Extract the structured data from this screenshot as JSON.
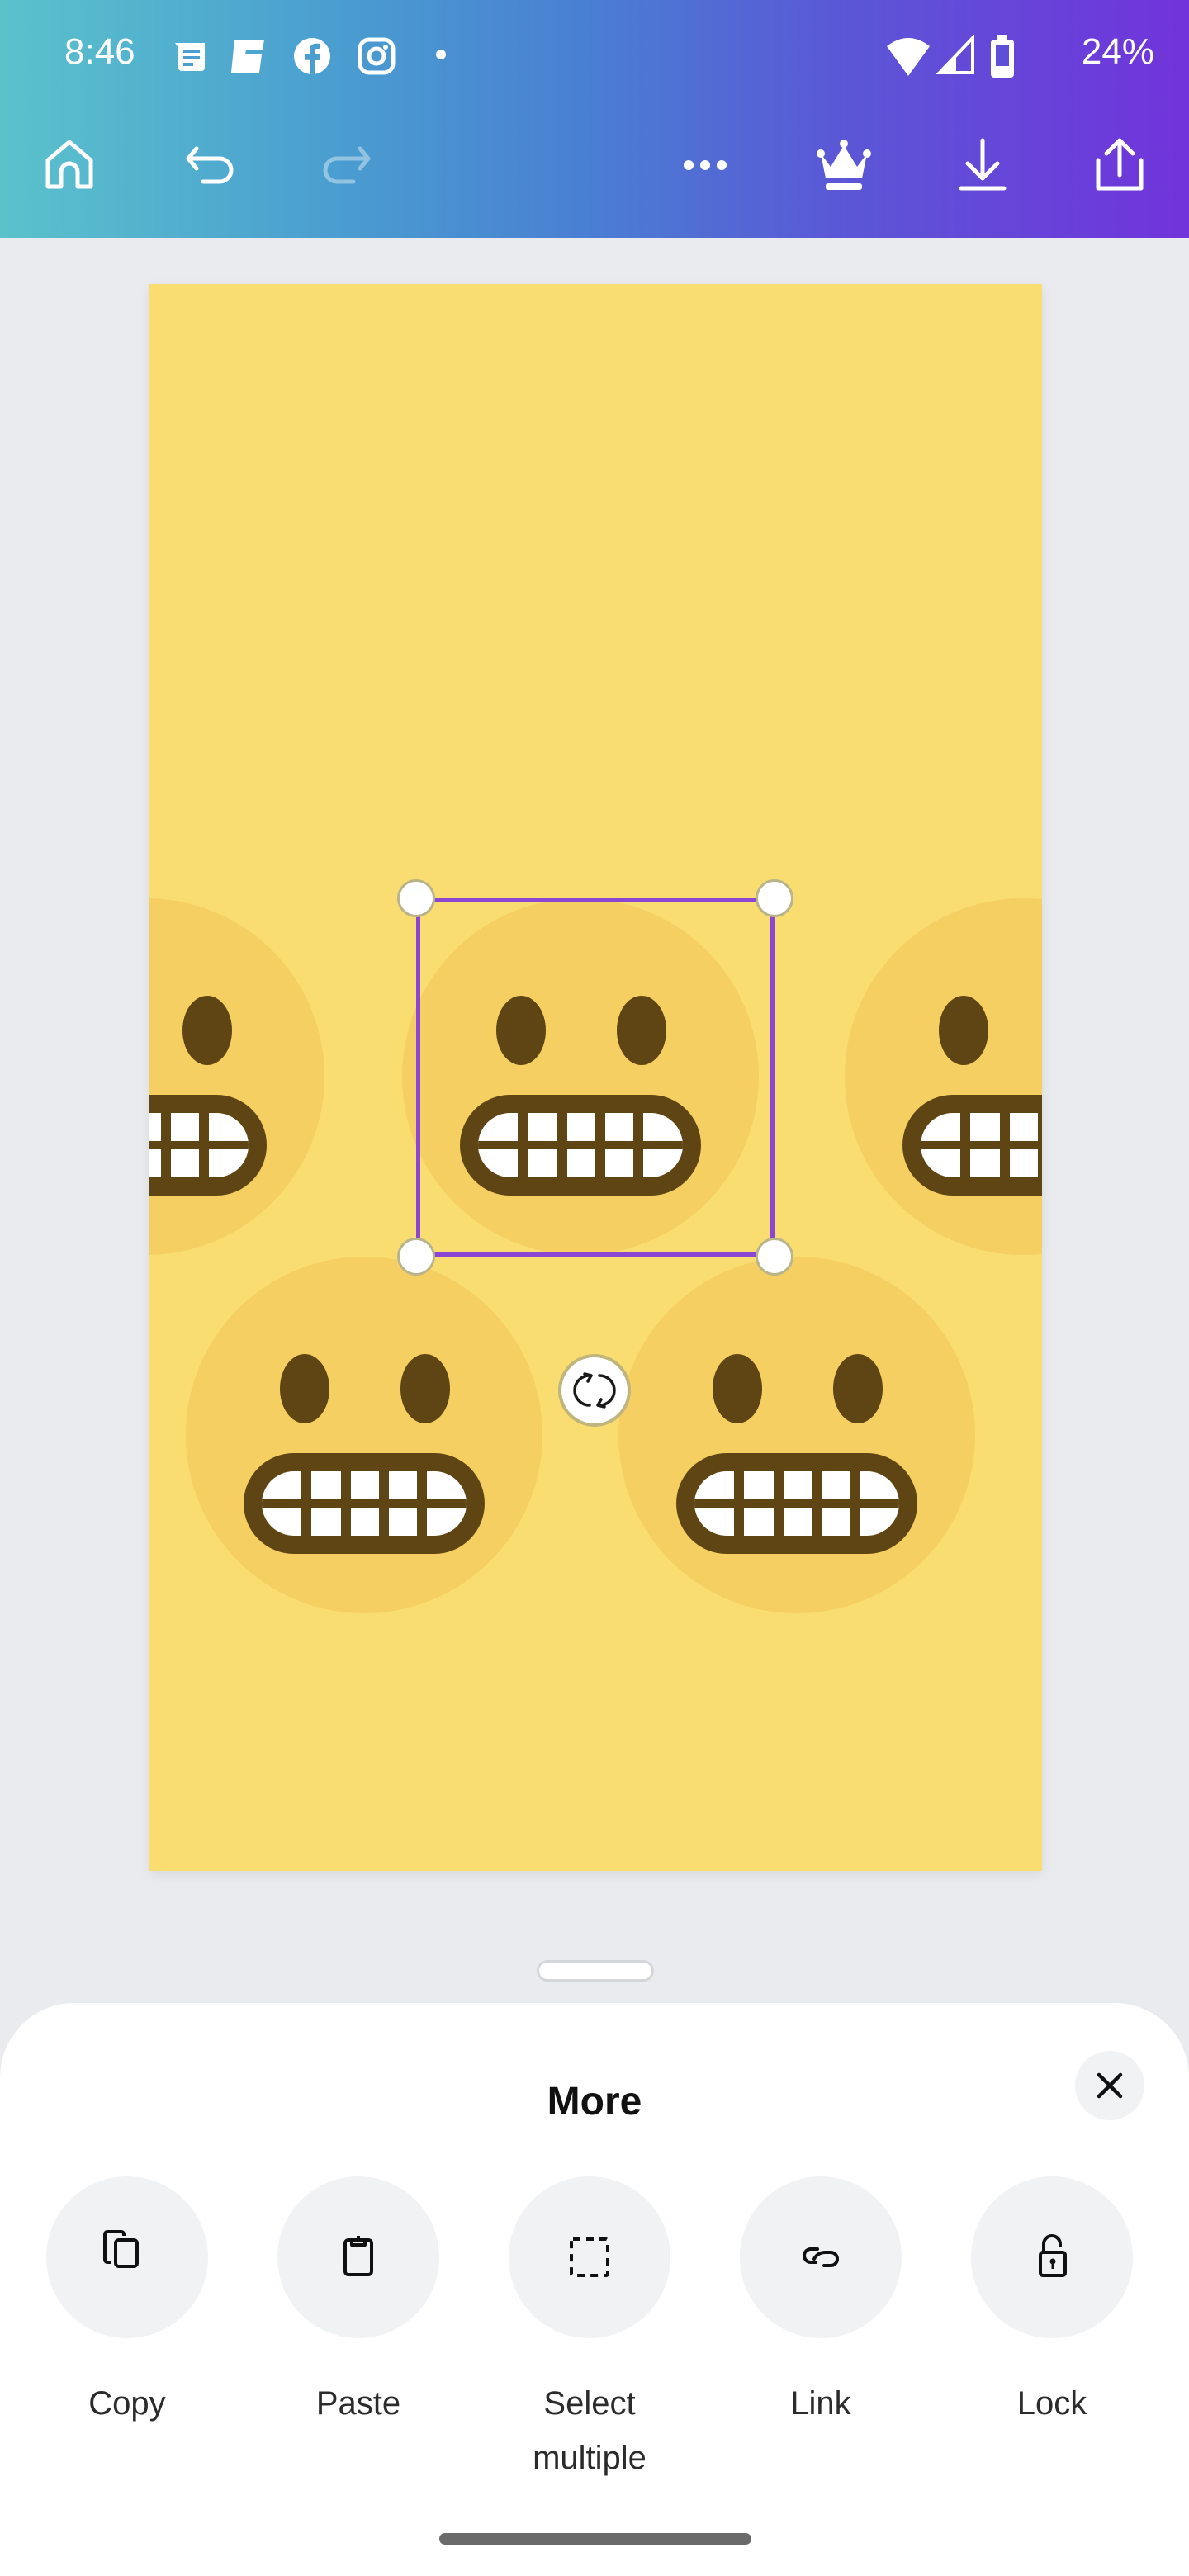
{
  "status_bar": {
    "time": "8:46",
    "notification_icons": [
      "news-icon",
      "app-e-icon",
      "facebook-icon",
      "instagram-icon",
      "dot-icon"
    ],
    "wifi": "wifi-icon",
    "signal": "signal-icon",
    "battery_icon": "battery-icon",
    "battery_percent": "24%"
  },
  "toolbar": {
    "left": [
      {
        "name": "home",
        "icon": "home-icon",
        "enabled": true
      },
      {
        "name": "undo",
        "icon": "undo-icon",
        "enabled": true
      },
      {
        "name": "redo",
        "icon": "redo-icon",
        "enabled": false
      }
    ],
    "right": [
      {
        "name": "more",
        "icon": "more-dots-icon"
      },
      {
        "name": "premium",
        "icon": "crown-icon"
      },
      {
        "name": "download",
        "icon": "download-icon"
      },
      {
        "name": "share",
        "icon": "share-icon"
      }
    ]
  },
  "canvas": {
    "background_color": "#f9dd70",
    "elements": [
      {
        "type": "grimacing-face-emoji",
        "selected": false,
        "cropped": "left"
      },
      {
        "type": "grimacing-face-emoji",
        "selected": true
      },
      {
        "type": "grimacing-face-emoji",
        "selected": false,
        "cropped": "right"
      },
      {
        "type": "grimacing-face-emoji",
        "selected": false
      },
      {
        "type": "grimacing-face-emoji",
        "selected": false
      }
    ],
    "selection_color": "#8b46d3"
  },
  "sheet": {
    "title": "More",
    "close_icon": "close-icon",
    "actions": [
      {
        "label": "Copy",
        "icon": "copy-icon"
      },
      {
        "label": "Paste",
        "icon": "paste-icon"
      },
      {
        "label": "Select multiple",
        "icon": "select-multiple-icon"
      },
      {
        "label": "Link",
        "icon": "link-icon"
      },
      {
        "label": "Lock",
        "icon": "unlock-icon"
      }
    ]
  }
}
